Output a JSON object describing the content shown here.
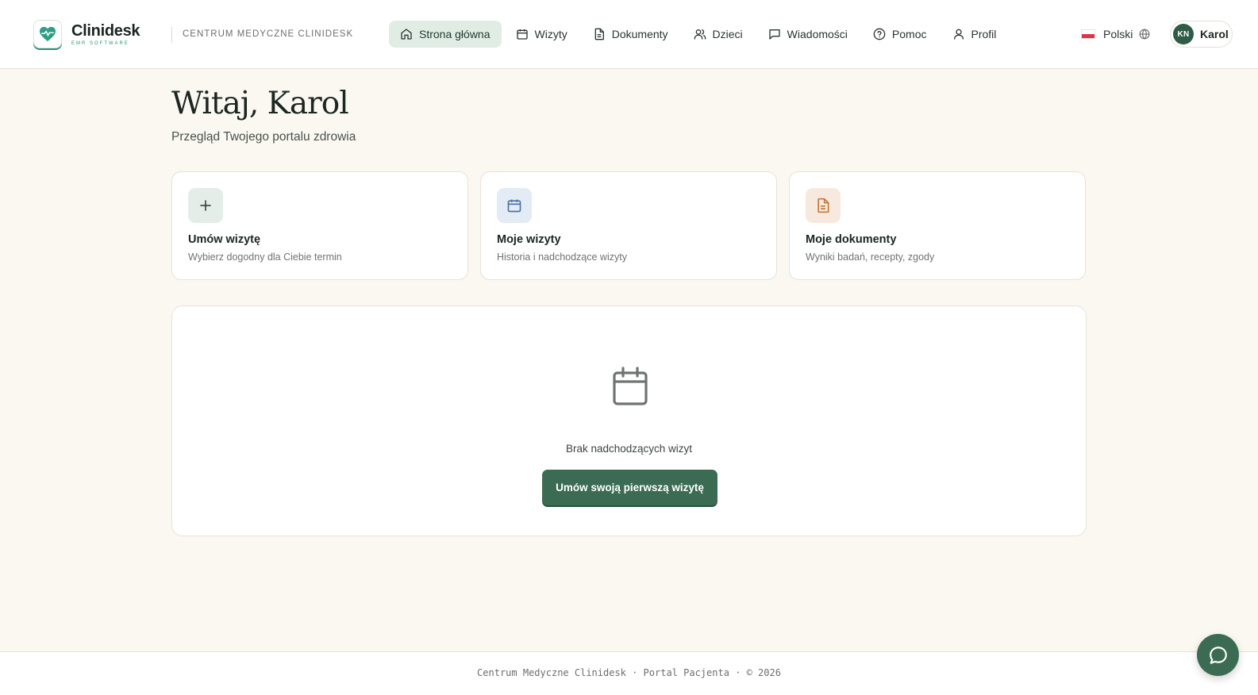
{
  "brand": {
    "name": "Clinidesk",
    "tagline": "EMR SOFTWARE",
    "organization": "CENTRUM MEDYCZNE CLINIDESK",
    "accent_color": "#2f8f78",
    "primary_color": "#3b6b52"
  },
  "nav": {
    "items": [
      {
        "label": "Strona główna",
        "icon": "home-icon",
        "active": true
      },
      {
        "label": "Wizyty",
        "icon": "calendar-icon",
        "active": false
      },
      {
        "label": "Dokumenty",
        "icon": "document-icon",
        "active": false
      },
      {
        "label": "Dzieci",
        "icon": "users-icon",
        "active": false
      },
      {
        "label": "Wiadomości",
        "icon": "message-icon",
        "active": false
      },
      {
        "label": "Pomoc",
        "icon": "help-icon",
        "active": false
      },
      {
        "label": "Profil",
        "icon": "user-icon",
        "active": false
      }
    ]
  },
  "language": {
    "label": "Polski",
    "flag": "flag-pl-icon"
  },
  "user": {
    "initials": "KN",
    "name": "Karol"
  },
  "main": {
    "greeting": "Witaj, Karol",
    "subtitle": "Przegląd Twojego portalu zdrowia",
    "cards": [
      {
        "title": "Umów wizytę",
        "description": "Wybierz dogodny dla Ciebie termin",
        "icon": "plus-icon"
      },
      {
        "title": "Moje wizyty",
        "description": "Historia i nadchodzące wizyty",
        "icon": "calendar-icon"
      },
      {
        "title": "Moje dokumenty",
        "description": "Wyniki badań, recepty, zgody",
        "icon": "document-icon"
      }
    ],
    "empty_state": {
      "icon": "calendar-icon",
      "text": "Brak nadchodzących wizyt",
      "cta_label": "Umów swoją pierwszą wizytę"
    }
  },
  "footer": {
    "text": "Centrum Medyczne Clinidesk · Portal Pacjenta · © 2026"
  },
  "chat": {
    "icon": "chat-bubble-icon"
  }
}
